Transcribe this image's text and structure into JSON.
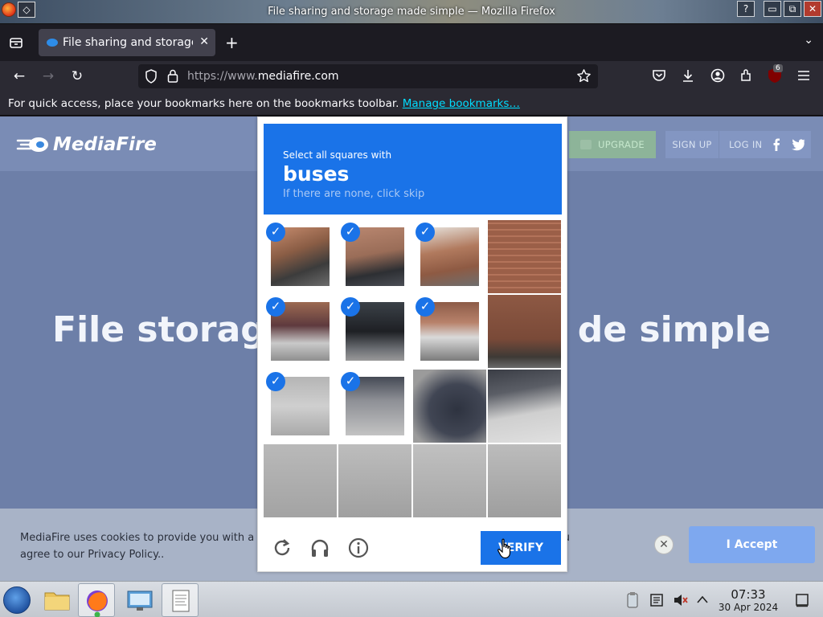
{
  "window": {
    "title": "File sharing and storage made simple — Mozilla Firefox",
    "help_btn": "?",
    "min_btn": "▭",
    "max_btn": "⧉",
    "close_btn": "✕"
  },
  "tabs": [
    {
      "label": "File sharing and storage made simple",
      "close": "✕"
    }
  ],
  "new_tab": "+",
  "nav": {
    "url_prefix": "https://www.",
    "url_domain": "mediafire.com",
    "extension_badge": "6"
  },
  "bookmarks_bar": {
    "message": "For quick access, place your bookmarks here on the bookmarks toolbar. ",
    "link": "Manage bookmarks…"
  },
  "site": {
    "logo_text": "MediaFire",
    "upgrade": "UPGRADE",
    "signup": "SIGN UP",
    "login": "LOG IN",
    "hero_left": "File storag",
    "hero_right": "de simple"
  },
  "cookie": {
    "text": "MediaFire uses cookies to provide you with a personalized experience. By continuing to use this site, you agree to our Privacy Policy..",
    "accept": "I Accept",
    "close": "✕"
  },
  "captcha": {
    "line1": "Select all squares with",
    "target": "buses",
    "line3": "If there are none, click skip",
    "verify": "VERIFY",
    "selected_tiles": [
      0,
      1,
      2,
      4,
      5,
      6,
      8,
      9
    ],
    "accent": "#1a73e8"
  },
  "taskbar": {
    "time": "07:33",
    "date": "30 Apr 2024"
  }
}
